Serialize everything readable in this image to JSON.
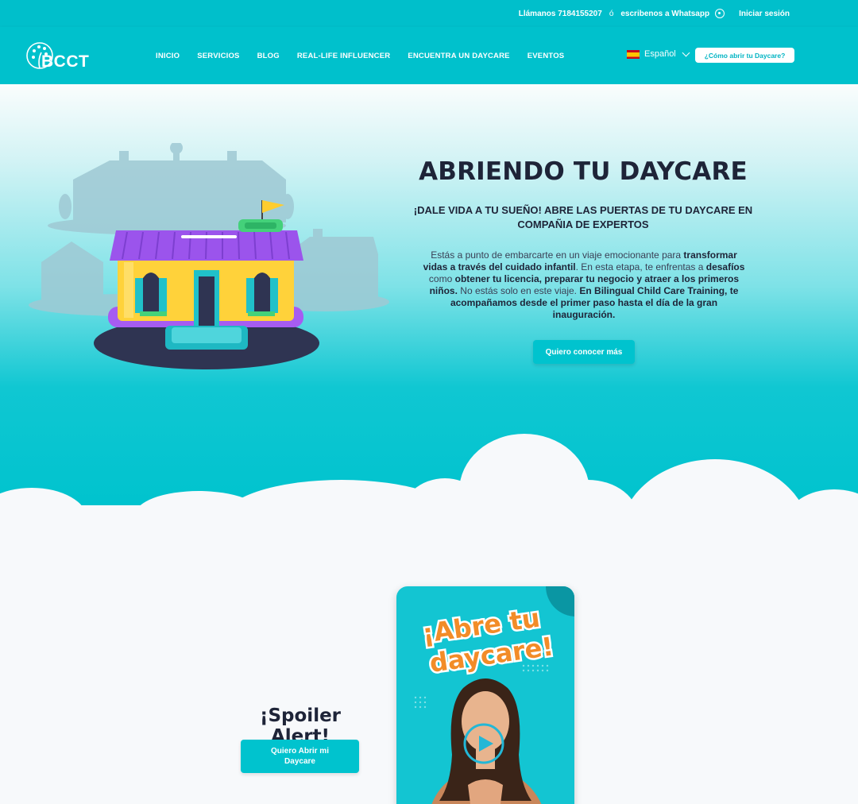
{
  "topbar": {
    "phone_text": "Llámanos 7184155207",
    "separator": "ó",
    "whatsapp_text": "escribenos a Whatsapp",
    "login_label": "Iniciar sesión"
  },
  "nav": {
    "logo_text": "BCCT",
    "items": [
      {
        "label": "INICIO"
      },
      {
        "label": "SERVICIOS"
      },
      {
        "label": "BLOG"
      },
      {
        "label": "REAL-LIFE INFLUENCER"
      },
      {
        "label": "ENCUENTRA UN DAYCARE"
      },
      {
        "label": "EVENTOS"
      }
    ],
    "language_label": "Español",
    "cta_label": "¿Cómo abrir tu Daycare?"
  },
  "hero": {
    "title": "ABRIENDO TU DAYCARE",
    "subtitle": "¡DALE VIDA A TU SUEÑO! ABRE LAS PUERTAS DE TU DAYCARE EN COMPAÑIA DE EXPERTOS",
    "p1": "Estás a punto de embarcarte en un viaje emocionante para ",
    "b1": "transformar vidas a través del cuidado infantil",
    "p2": ". En esta etapa, te enfrentas a ",
    "b2": "desafíos",
    "p3": " como ",
    "b3": "obtener tu licencia, preparar tu negocio y atraer a los primeros niños.",
    "p4": " No estás solo en este viaje. ",
    "b4": "En Bilingual Child Care Training, te acompañamos desde el primer paso hasta el día de la gran inauguración.",
    "button_label": "Quiero conocer más"
  },
  "spoiler": {
    "title": "¡Spoiler Alert!",
    "button_label": "Quiero Abrir mi Daycare"
  },
  "video": {
    "title_line1": "¡Abre tu",
    "title_line2": "daycare!"
  },
  "colors": {
    "brand": "#00c1cc",
    "dark_text": "#1e2438",
    "video_title": "#f28c28"
  }
}
